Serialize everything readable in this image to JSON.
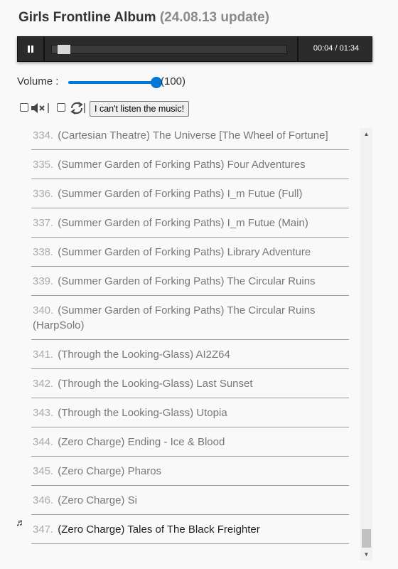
{
  "header": {
    "title": "Girls Frontline Album",
    "update": "(24.08.13 update)"
  },
  "player": {
    "state_icon": "pause-icon",
    "current_time": "00:04",
    "duration": "01:34",
    "progress": 0.0426
  },
  "volume": {
    "label": "Volume :",
    "value_text": "(100)",
    "level": 1.0,
    "accent": "#0078d7"
  },
  "controls": {
    "mute_icon": "speaker-mute-icon",
    "repeat_icon": "repeat-icon",
    "separator": "|",
    "cant_listen_label": "I can't listen the music!"
  },
  "playlist": {
    "current_icon": "♬",
    "items": [
      {
        "num": "334.",
        "title": "(Cartesian Theatre) The Universe [The Wheel of Fortune]",
        "current": false
      },
      {
        "num": "335.",
        "title": "(Summer Garden of Forking Paths) Four Adventures",
        "current": false
      },
      {
        "num": "336.",
        "title": "(Summer Garden of Forking Paths) I_m Futue (Full)",
        "current": false
      },
      {
        "num": "337.",
        "title": "(Summer Garden of Forking Paths) I_m Futue (Main)",
        "current": false
      },
      {
        "num": "338.",
        "title": "(Summer Garden of Forking Paths) Library Adventure",
        "current": false
      },
      {
        "num": "339.",
        "title": "(Summer Garden of Forking Paths) The Circular Ruins",
        "current": false
      },
      {
        "num": "340.",
        "title": "(Summer Garden of Forking Paths) The Circular Ruins (HarpSolo)",
        "current": false
      },
      {
        "num": "341.",
        "title": "(Through the Looking-Glass) AI2Z64",
        "current": false
      },
      {
        "num": "342.",
        "title": "(Through the Looking-Glass) Last Sunset",
        "current": false
      },
      {
        "num": "343.",
        "title": "(Through the Looking-Glass) Utopia",
        "current": false
      },
      {
        "num": "344.",
        "title": "(Zero Charge) Ending - Ice & Blood",
        "current": false
      },
      {
        "num": "345.",
        "title": "(Zero Charge) Pharos",
        "current": false
      },
      {
        "num": "346.",
        "title": "(Zero Charge) Si",
        "current": false
      },
      {
        "num": "347.",
        "title": "(Zero Charge) Tales of The Black Freighter",
        "current": true
      }
    ]
  }
}
